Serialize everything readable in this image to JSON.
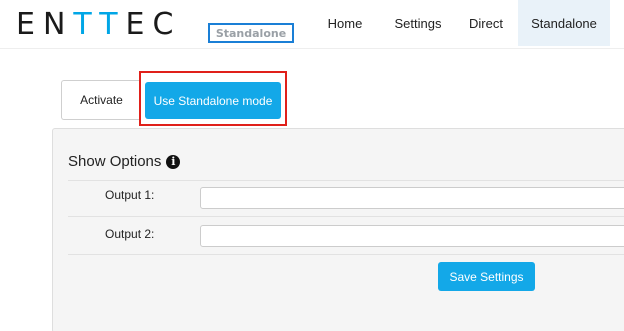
{
  "header": {
    "logo": {
      "part1": "EN",
      "part2": "TT",
      "part3": "EC"
    },
    "mode_badge": "Standalone",
    "nav": [
      {
        "label": "Home"
      },
      {
        "label": "Settings"
      },
      {
        "label": "Direct"
      },
      {
        "label": "Standalone",
        "active": true
      }
    ]
  },
  "actions": {
    "activate_label": "Activate",
    "standalone_label": "Use Standalone mode"
  },
  "show_options": {
    "title": "Show Options",
    "info_icon": "info-circle-icon",
    "fields": [
      {
        "label": "Output 1:",
        "value": ""
      },
      {
        "label": "Output 2:",
        "value": ""
      }
    ],
    "save_label": "Save Settings"
  },
  "colors": {
    "accent": "#13a8e8",
    "logo_accent": "#00a6e6",
    "highlight": "#e0201a",
    "badge_border": "#1a7fd6",
    "active_tab_bg": "#e9f2f9"
  }
}
